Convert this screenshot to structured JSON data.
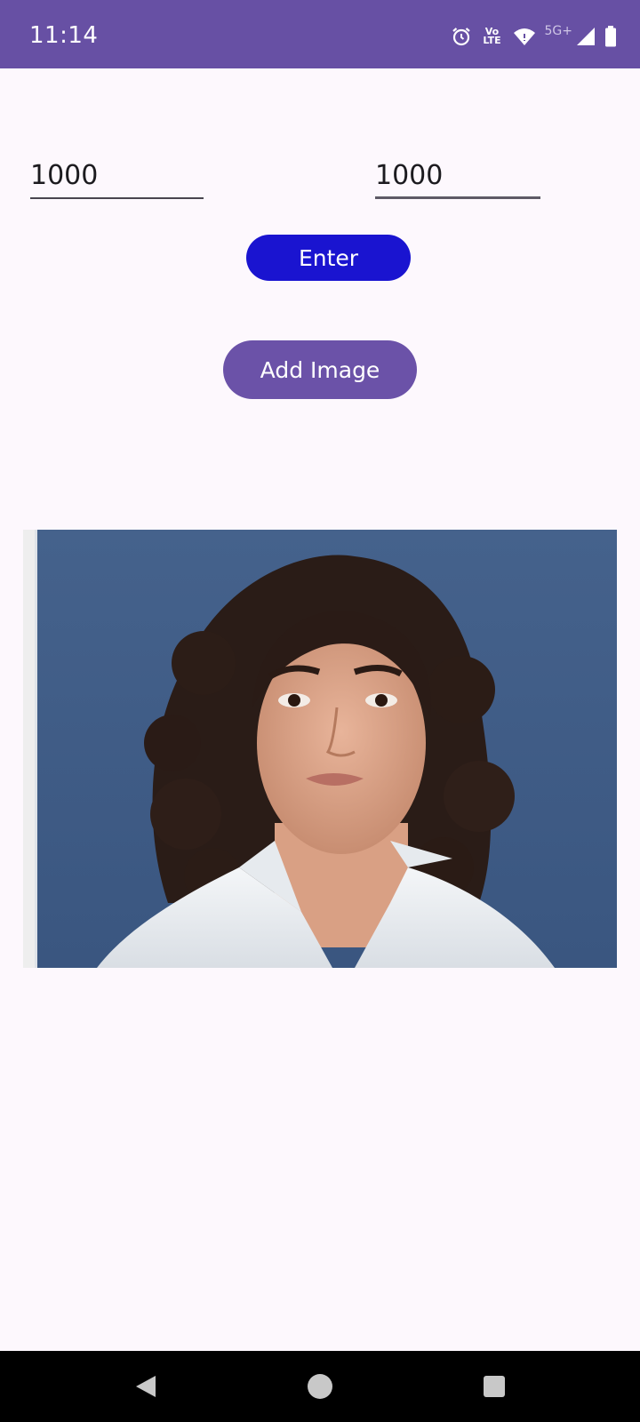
{
  "status_bar": {
    "time": "11:14",
    "volte_top": "Vo",
    "volte_bottom": "LTE",
    "network": "5G+",
    "icons": [
      "alarm-icon",
      "volte-icon",
      "wifi-icon",
      "signal-icon",
      "battery-icon"
    ],
    "background_color": "#6750a4"
  },
  "form": {
    "width_value": "1000",
    "height_value": "1000",
    "enter_label": "Enter",
    "enter_color": "#1a14d0",
    "add_image_label": "Add Image",
    "add_image_color": "#6b52a8"
  },
  "image": {
    "content": "portrait photo of a woman with curly dark hair in a white shirt against a blue background"
  },
  "nav_bar": {
    "icons": [
      "back-icon",
      "home-icon",
      "recents-icon"
    ]
  }
}
